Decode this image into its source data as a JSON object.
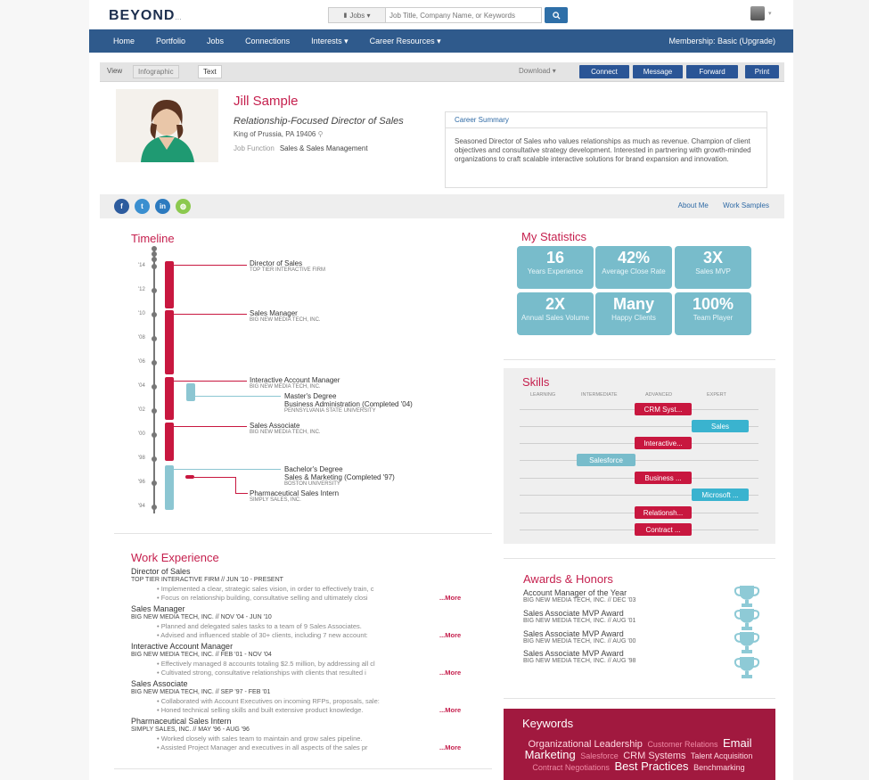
{
  "brand": {
    "logo": "BEYOND",
    "logo_suffix": "..."
  },
  "search": {
    "category": "Jobs ▾",
    "placeholder": "Job Title, Company Name, or Keywords",
    "button_icon": "search-icon"
  },
  "nav": {
    "items": [
      "Home",
      "Portfolio",
      "Jobs",
      "Connections",
      "Interests ▾",
      "Career Resources ▾"
    ],
    "membership": "Membership: Basic (Upgrade)"
  },
  "toolbar": {
    "view_label": "View",
    "tabs": [
      "Infographic",
      "Text"
    ],
    "download": "Download ▾",
    "buttons": [
      "Connect",
      "Message",
      "Forward",
      "Print"
    ]
  },
  "profile": {
    "name": "Jill Sample",
    "headline": "Relationship-Focused Director of Sales",
    "location": "King of Prussia, PA 19406",
    "job_function_label": "Job Function",
    "job_function": "Sales & Sales Management",
    "summary_title": "Career Summary",
    "summary_text": "Seasoned Director of Sales who values relationships as much as revenue. Champion of client objectives and consultative strategy development. Interested in partnering with growth-minded organizations to craft scalable interactive solutions for brand expansion and innovation."
  },
  "social": {
    "icons": [
      "facebook-icon",
      "twitter-icon",
      "linkedin-icon",
      "website-icon"
    ],
    "links": [
      "About Me",
      "Work Samples"
    ]
  },
  "timeline": {
    "title": "Timeline",
    "years": [
      "'14",
      "'12",
      "'10",
      "'08",
      "'06",
      "'04",
      "'02",
      "'00",
      "'98",
      "'96",
      "'94"
    ],
    "entries": [
      {
        "role": "Director of Sales",
        "org": "TOP TIER INTERACTIVE FIRM"
      },
      {
        "role": "Sales Manager",
        "org": "BIG NEW MEDIA TECH, INC."
      },
      {
        "role": "Interactive Account Manager",
        "org": "BIG NEW MEDIA TECH, INC."
      },
      {
        "role": "Master's Degree",
        "role2": "Business Administration (Completed '04)",
        "org": "PENNSYLVANIA STATE UNIVERSITY"
      },
      {
        "role": "Sales Associate",
        "org": "BIG NEW MEDIA TECH, INC."
      },
      {
        "role": "Bachelor's Degree",
        "role2": "Sales & Marketing (Completed '97)",
        "org": "BOSTON UNIVERSITY"
      },
      {
        "role": "Pharmaceutical Sales Intern",
        "org": "SIMPLY SALES, INC."
      }
    ]
  },
  "stats": {
    "title": "My Statistics",
    "items": [
      {
        "value": "16",
        "label": "Years Experience"
      },
      {
        "value": "42%",
        "label": "Average Close Rate"
      },
      {
        "value": "3X",
        "label": "Sales MVP"
      },
      {
        "value": "2X",
        "label": "Annual Sales Volume"
      },
      {
        "value": "Many",
        "label": "Happy Clients"
      },
      {
        "value": "100%",
        "label": "Team Player"
      }
    ]
  },
  "skills": {
    "title": "Skills",
    "levels": [
      "LEARNING",
      "INTERMEDIATE",
      "ADVANCED",
      "EXPERT"
    ],
    "items": [
      {
        "name": "CRM Syst...",
        "level": "Advanced",
        "color": "#c8173f"
      },
      {
        "name": "Sales",
        "level": "Expert",
        "color": "#3ab3cf"
      },
      {
        "name": "Interactive...",
        "level": "Advanced",
        "color": "#c8173f"
      },
      {
        "name": "Salesforce",
        "level": "Intermediate",
        "color": "#78bccb"
      },
      {
        "name": "Business ...",
        "level": "Advanced",
        "color": "#c8173f"
      },
      {
        "name": "Microsoft ...",
        "level": "Expert",
        "color": "#3ab3cf"
      },
      {
        "name": "Relationsh...",
        "level": "Advanced",
        "color": "#c8173f"
      },
      {
        "name": "Contract ...",
        "level": "Advanced",
        "color": "#c8173f"
      }
    ]
  },
  "work": {
    "title": "Work Experience",
    "more_label": "...More",
    "jobs": [
      {
        "title": "Director of Sales",
        "org": "TOP TIER INTERACTIVE FIRM // JUN '10 - PRESENT",
        "bullets": [
          "Implemented a clear, strategic sales vision, in order to effectively train, c",
          "Focus on relationship building, consultative selling and ultimately closi"
        ]
      },
      {
        "title": "Sales Manager",
        "org": "BIG NEW MEDIA TECH, INC. // NOV '04 - JUN '10",
        "bullets": [
          "Planned and delegated sales tasks to a team of 9 Sales Associates.",
          "Advised and influenced stable of 30+ clients, including 7 new account:"
        ]
      },
      {
        "title": "Interactive Account Manager",
        "org": "BIG NEW MEDIA TECH, INC. // FEB '01 - NOV '04",
        "bullets": [
          "Effectively managed 8 accounts totaling $2.5 million, by addressing all cl",
          "Cultivated strong, consultative relationships with clients that resulted i"
        ]
      },
      {
        "title": "Sales Associate",
        "org": "BIG NEW MEDIA TECH, INC. // SEP '97 - FEB '01",
        "bullets": [
          "Collaborated with Account Executives on incoming RFPs, proposals, sale:",
          "Honed technical selling skills and built extensive product knowledge."
        ]
      },
      {
        "title": "Pharmaceutical Sales Intern",
        "org": "SIMPLY SALES, INC. // MAY '96 - AUG '96",
        "bullets": [
          "Worked closely with sales team to maintain and grow sales pipeline.",
          "Assisted Project Manager and executives in all aspects of the sales pr"
        ]
      }
    ]
  },
  "awards": {
    "title": "Awards & Honors",
    "items": [
      {
        "title": "Account Manager of the Year",
        "org": "BIG NEW MEDIA TECH, INC. // DEC '03"
      },
      {
        "title": "Sales Associate MVP Award",
        "org": "BIG NEW MEDIA TECH, INC. // AUG '01"
      },
      {
        "title": "Sales Associate MVP Award",
        "org": "BIG NEW MEDIA TECH, INC. // AUG '00"
      },
      {
        "title": "Sales Associate MVP Award",
        "org": "BIG NEW MEDIA TECH, INC. // AUG '98"
      }
    ]
  },
  "keywords": {
    "title": "Keywords",
    "words": [
      {
        "text": "Organizational Leadership",
        "weight": "mid",
        "color": "#ffd6e0"
      },
      {
        "text": "Customer Relations",
        "weight": "small",
        "color": "#f08aa5"
      },
      {
        "text": "Email Marketing",
        "weight": "big",
        "color": "#ffffff"
      },
      {
        "text": "Salesforce",
        "weight": "small",
        "color": "#f08aa5"
      },
      {
        "text": "CRM Systems",
        "weight": "mid",
        "color": "#ffd6e0"
      },
      {
        "text": "Talent Acquisition",
        "weight": "small",
        "color": "#ffd6e0"
      },
      {
        "text": "Contract Negotiations",
        "weight": "small",
        "color": "#f08aa5"
      },
      {
        "text": "Best Practices",
        "weight": "big",
        "color": "#ffffff"
      },
      {
        "text": "Benchmarking",
        "weight": "small",
        "color": "#ffd6e0"
      }
    ]
  },
  "colors": {
    "brand_red": "#c51f4d",
    "nav_blue": "#2f5a8c",
    "stat_teal": "#78bccb",
    "keyword_bg": "#a1193f"
  }
}
